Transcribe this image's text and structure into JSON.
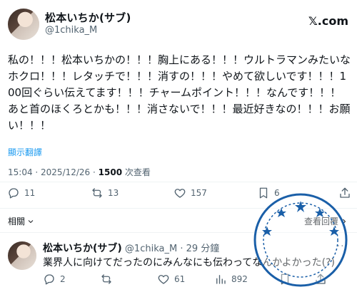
{
  "post": {
    "display_name": "松本いちか(サブ)",
    "handle": "@1chika_M",
    "brand": "𝕏.com",
    "text": "私の！！！松本いちかの！！！胸上にある！！！ウルトラマンみたいなホクロ！！！レタッチで！！！消すの！！！やめて欲しいです！！！100回ぐらい伝えてます！！！チャームポイント！！！なんです！！！あと首のほくろとかも！！！消さないで！！！最近好きなの！！！お願い！！！",
    "translate": "顯示翻譯",
    "time": "15:04 · 2025/12/26 · ",
    "views_count": "1500",
    "views_label": " 次查看",
    "actions": {
      "replies": "11",
      "reposts": "13",
      "likes": "157",
      "bookmarks": "6"
    }
  },
  "related": {
    "label": "相關",
    "view_more": "查看回覆"
  },
  "reply": {
    "display_name": "松本いちか(サブ)",
    "meta": " @1chika_M · 29 分鐘",
    "text": "業界人に向けてだったのにみんなにも伝わってなんかよかった(?)",
    "actions": {
      "replies": "2",
      "likes": "61",
      "views": "892"
    }
  },
  "icons": [
    "reply-icon",
    "repost-icon",
    "like-icon",
    "bookmark-icon",
    "share-icon",
    "views-icon",
    "chevron-down-icon",
    "more-icon"
  ],
  "colors": {
    "link": "#1d9bf0",
    "muted": "#536471",
    "text": "#0f1419",
    "divider": "#eff3f4"
  }
}
